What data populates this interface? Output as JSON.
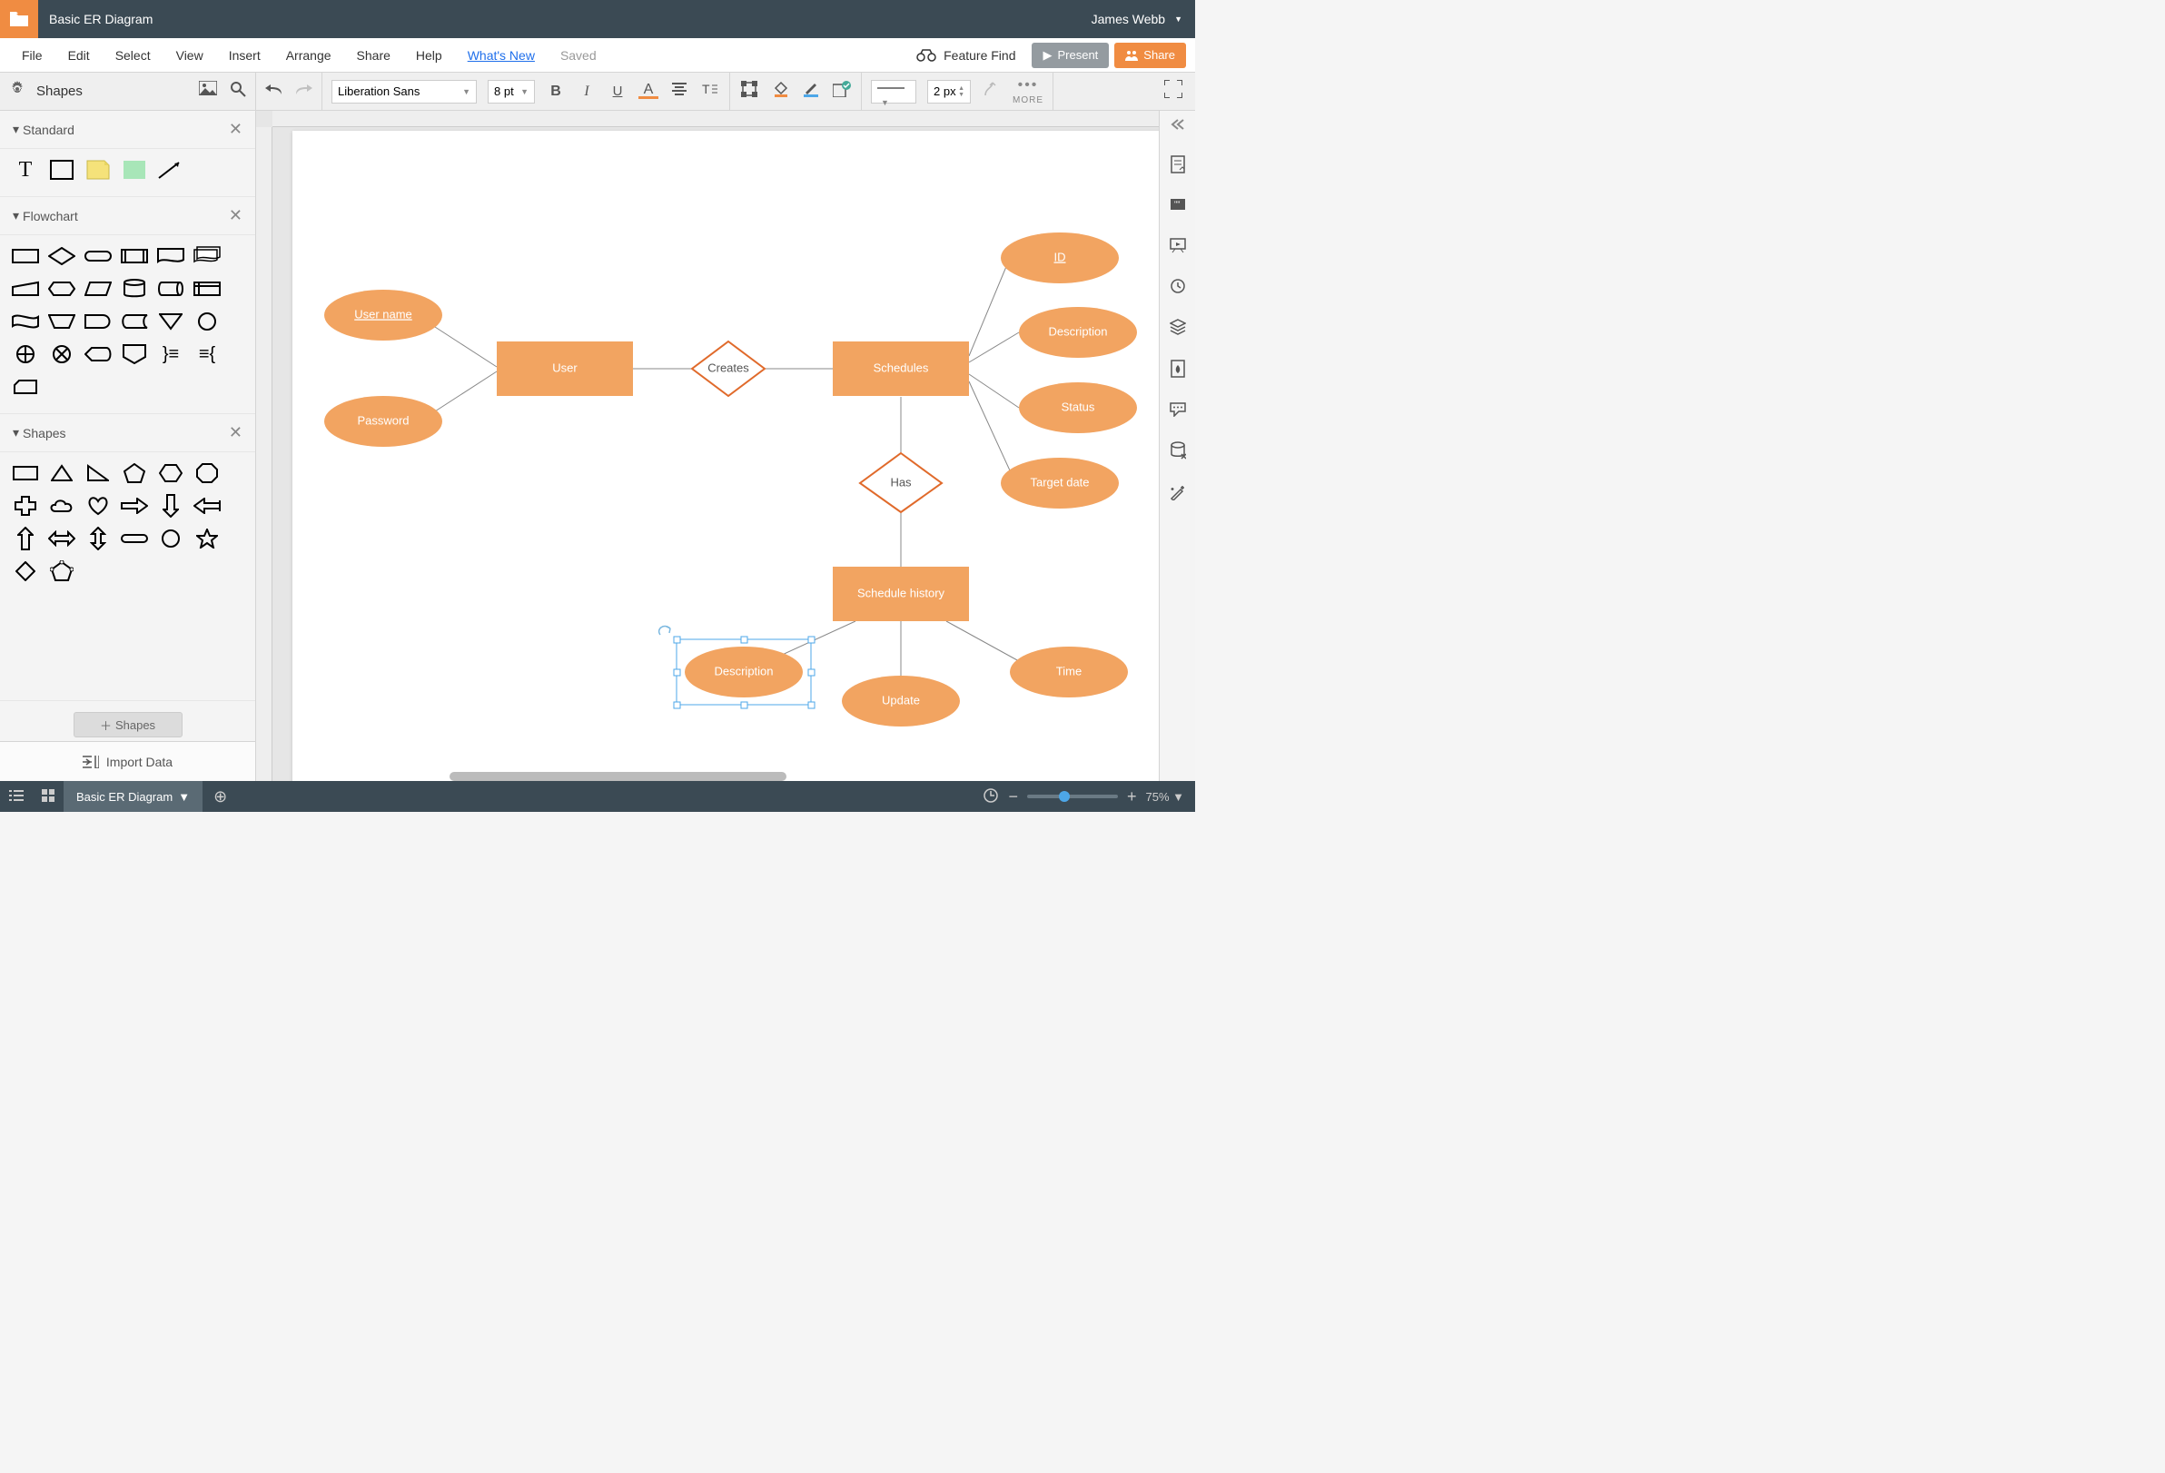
{
  "titlebar": {
    "title": "Basic ER Diagram",
    "user": "James Webb"
  },
  "menubar": {
    "items": [
      "File",
      "Edit",
      "Select",
      "View",
      "Insert",
      "Arrange",
      "Share",
      "Help"
    ],
    "whatsnew": "What's New",
    "saved": "Saved",
    "feature": "Feature Find",
    "present": "Present",
    "share": "Share"
  },
  "toolbar": {
    "shapes": "Shapes",
    "font": "Liberation Sans",
    "fontsize": "8 pt",
    "linewidth": "2 px",
    "more": "MORE"
  },
  "leftpanel": {
    "groups": [
      {
        "name": "Standard"
      },
      {
        "name": "Flowchart"
      },
      {
        "name": "Shapes"
      }
    ],
    "shapesBtn": "Shapes",
    "import": "Import Data"
  },
  "diagram": {
    "nodes": {
      "username": "User name",
      "password": "Password",
      "user": "User",
      "creates": "Creates",
      "schedules": "Schedules",
      "id": "ID",
      "description": "Description",
      "status": "Status",
      "targetdate": "Target date",
      "has": "Has",
      "schedulehistory": "Schedule history",
      "desc2": "Description",
      "update": "Update",
      "time": "Time"
    }
  },
  "bottombar": {
    "tab": "Basic ER Diagram",
    "zoom": "75%"
  }
}
